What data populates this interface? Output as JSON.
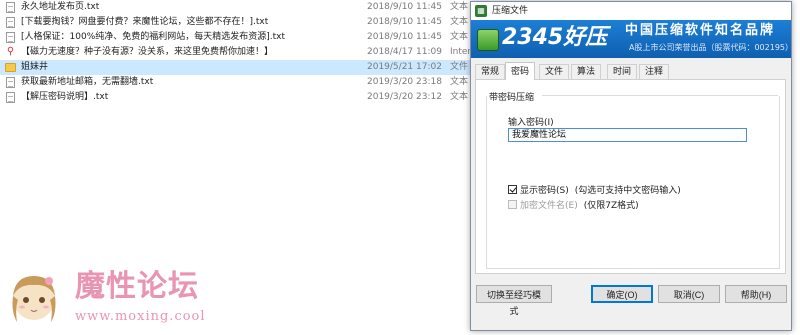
{
  "file_list": {
    "rows": [
      {
        "name": "永久地址发布页.txt",
        "date": "2018/9/10 11:45",
        "type": "文本",
        "icon": "text-file-icon"
      },
      {
        "name": "[下载要掏钱？网盘要付费？来魔性论坛，这些都不存在！].txt",
        "date": "2018/9/10 11:45",
        "type": "文本",
        "icon": "text-file-icon"
      },
      {
        "name": "[人格保证：100%纯净、免费的福利网站，每天精选发布资源].txt",
        "date": "2018/9/10 11:45",
        "type": "文本",
        "icon": "text-file-icon"
      },
      {
        "name": "【磁力无速度？种子没有源？没关系，来这里免费帮你加速！】",
        "date": "2018/4/17 11:09",
        "type": "Inter",
        "icon": "internet-shortcut-icon"
      },
      {
        "name": "姐妹井",
        "date": "2019/5/21 17:02",
        "type": "文件",
        "icon": "folder-icon",
        "selected": true
      },
      {
        "name": "获取最新地址邮箱，无需翻墙.txt",
        "date": "2019/3/20 23:18",
        "type": "文本",
        "icon": "text-file-icon"
      },
      {
        "name": "【解压密码说明】.txt",
        "date": "2019/3/20 23:12",
        "type": "文本",
        "icon": "text-file-icon"
      }
    ]
  },
  "watermark": {
    "title": "魔性论坛",
    "url": "www.moxing.cool",
    "color": "#e994b1"
  },
  "dialog": {
    "title": "压缩文件",
    "banner": {
      "logo_text": "2345好压",
      "slogan": "中国压缩软件知名品牌",
      "subtitle": "A股上市公司荣誉出品（股票代码：002195）",
      "color": "#1c7fd6"
    },
    "tabs": [
      {
        "label": "常规",
        "active": false
      },
      {
        "label": "密码",
        "active": true
      },
      {
        "label": "文件",
        "active": false
      },
      {
        "label": "算法",
        "active": false
      },
      {
        "label": "时间",
        "active": false
      },
      {
        "label": "注释",
        "active": false
      }
    ],
    "password_group": {
      "label": "带密码压缩",
      "input_label": "输入密码(I)",
      "input_value": "我爱魔性论坛",
      "show_password": {
        "label": "显示密码(S)",
        "hint": "(勾选可支持中文密码输入)",
        "checked": true
      },
      "encrypt_names": {
        "label": "加密文件名(E)",
        "hint": "(仅限7Z格式)",
        "checked": false,
        "disabled": true
      }
    },
    "buttons": {
      "expert_mode": "切换至经巧模式",
      "ok": "确定(O)",
      "cancel": "取消(C)",
      "help": "帮助(H)"
    }
  }
}
